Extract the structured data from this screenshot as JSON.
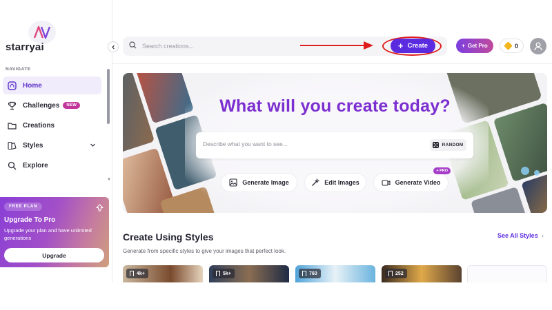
{
  "brand": {
    "name": "starryai"
  },
  "search": {
    "placeholder": "Search creations..."
  },
  "header": {
    "create_label": "Create",
    "getpro_label": "Get Pro",
    "coin_count": "0"
  },
  "sidebar": {
    "heading": "NAVIGATE",
    "items": [
      {
        "label": "Home",
        "icon": "home-icon",
        "active": true
      },
      {
        "label": "Challenges",
        "icon": "trophy-icon",
        "badge": "NEW"
      },
      {
        "label": "Creations",
        "icon": "folder-icon"
      },
      {
        "label": "Styles",
        "icon": "styles-icon"
      },
      {
        "label": "Explore",
        "icon": "search-icon"
      }
    ]
  },
  "promo": {
    "plan_label": "FREE PLAN",
    "title": "Upgrade To Pro",
    "text": "Upgrade your plan and have unlimited generations",
    "button_label": "Upgrade"
  },
  "hero": {
    "title": "What will you create today?",
    "prompt_placeholder": "Describe what you want to see...",
    "random_label": "RANDOM",
    "actions": [
      {
        "label": "Generate Image",
        "icon": "image-icon"
      },
      {
        "label": "Edit Images",
        "icon": "magic-wand-icon"
      },
      {
        "label": "Generate Video",
        "icon": "video-icon",
        "tag": "PRO"
      }
    ]
  },
  "styles_section": {
    "title": "Create Using Styles",
    "subtitle": "Generate from specific styles to give your images that perfect look.",
    "see_all_label": "See All Styles",
    "cards": [
      {
        "count": "4k+"
      },
      {
        "count": "5k+"
      },
      {
        "count": "760"
      },
      {
        "count": "252"
      }
    ]
  },
  "colors": {
    "accent": "#5b2be0",
    "title_purple": "#7c2fd0",
    "annotation_red": "#e01b1b",
    "new_badge": "#c2359a"
  }
}
